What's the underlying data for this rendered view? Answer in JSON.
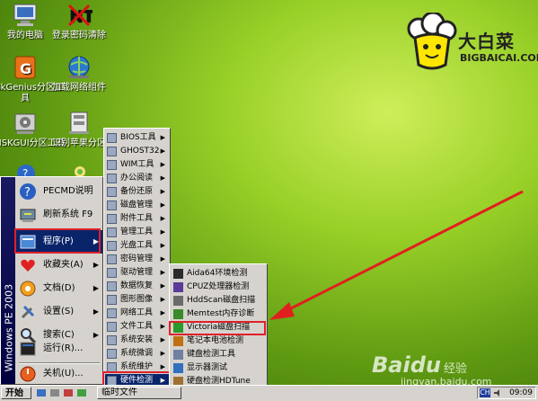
{
  "desktop": {
    "icons": [
      {
        "label": "我的电脑",
        "icon": "computer-icon"
      },
      {
        "label": "登录密码清除",
        "icon": "nt-password-icon"
      },
      {
        "label": "DiskGenius分区工具",
        "icon": "diskgenius-icon"
      },
      {
        "label": "加载网络组件",
        "icon": "network-globe-icon"
      },
      {
        "label": "GDISKGUI分区工具",
        "icon": "gdisk-icon"
      },
      {
        "label": "识别苹果分区",
        "icon": "apple-partition-icon"
      }
    ],
    "logo": {
      "cn": "大白菜",
      "en": "BIGBAICAI.COM"
    }
  },
  "start_menu": {
    "side_text": "Windows PE 2003",
    "items": [
      {
        "label": "PECMD说明",
        "icon": "help-icon"
      },
      {
        "label": "刷新系统 F9",
        "icon": "refresh-icon"
      },
      {
        "label": "程序(P)",
        "icon": "programs-icon",
        "submenu": true,
        "selected": true
      },
      {
        "label": "收藏夹(A)",
        "icon": "favorites-icon",
        "submenu": true
      },
      {
        "label": "文档(D)",
        "icon": "documents-icon",
        "submenu": true
      },
      {
        "label": "设置(S)",
        "icon": "settings-icon",
        "submenu": true
      },
      {
        "label": "搜索(C)",
        "icon": "search-icon",
        "submenu": true
      },
      {
        "label": "运行(R)...",
        "icon": "run-icon"
      },
      {
        "label": "关机(U)...",
        "icon": "shutdown-icon"
      }
    ]
  },
  "programs_menu": {
    "items": [
      {
        "label": "BIOS工具"
      },
      {
        "label": "GHOST32"
      },
      {
        "label": "WIM工具"
      },
      {
        "label": "办公阅读"
      },
      {
        "label": "备份还原"
      },
      {
        "label": "磁盘管理"
      },
      {
        "label": "附件工具"
      },
      {
        "label": "管理工具"
      },
      {
        "label": "光盘工具"
      },
      {
        "label": "密码管理"
      },
      {
        "label": "驱动管理"
      },
      {
        "label": "数据恢复"
      },
      {
        "label": "图形图像"
      },
      {
        "label": "网络工具"
      },
      {
        "label": "文件工具"
      },
      {
        "label": "系统安装"
      },
      {
        "label": "系统微调"
      },
      {
        "label": "系统维护"
      },
      {
        "label": "硬件检测",
        "selected": true
      }
    ]
  },
  "hardware_menu": {
    "items": [
      {
        "label": "Aida64环境检测",
        "icon": "aida64-icon",
        "color": "#2b2b2b"
      },
      {
        "label": "CPUZ处理器检测",
        "icon": "cpuz-icon",
        "color": "#5a3a9a"
      },
      {
        "label": "HddScan磁盘扫描",
        "icon": "hddscan-icon",
        "color": "#6a6a6a"
      },
      {
        "label": "Memtest内存诊断",
        "icon": "memtest-icon",
        "color": "#3a8a2a"
      },
      {
        "label": "Victoria磁盘扫描",
        "icon": "victoria-icon",
        "color": "#2a9a2a",
        "highlighted": true
      },
      {
        "label": "笔记本电池检测",
        "icon": "battery-icon",
        "color": "#c07010"
      },
      {
        "label": "键盘检测工具",
        "icon": "keyboard-icon",
        "color": "#7080a0"
      },
      {
        "label": "显示器测试",
        "icon": "monitor-icon",
        "color": "#3070c0"
      },
      {
        "label": "硬盘检测HDTune",
        "icon": "hdtune-icon",
        "color": "#a07030"
      }
    ]
  },
  "taskbar": {
    "start_label": "开始",
    "task_label": "临时文件",
    "ime_label": "CH",
    "clock": "09:09"
  },
  "watermark": {
    "brand": "Baidu",
    "cn": "经验",
    "url": "jingyan.baidu.com"
  }
}
